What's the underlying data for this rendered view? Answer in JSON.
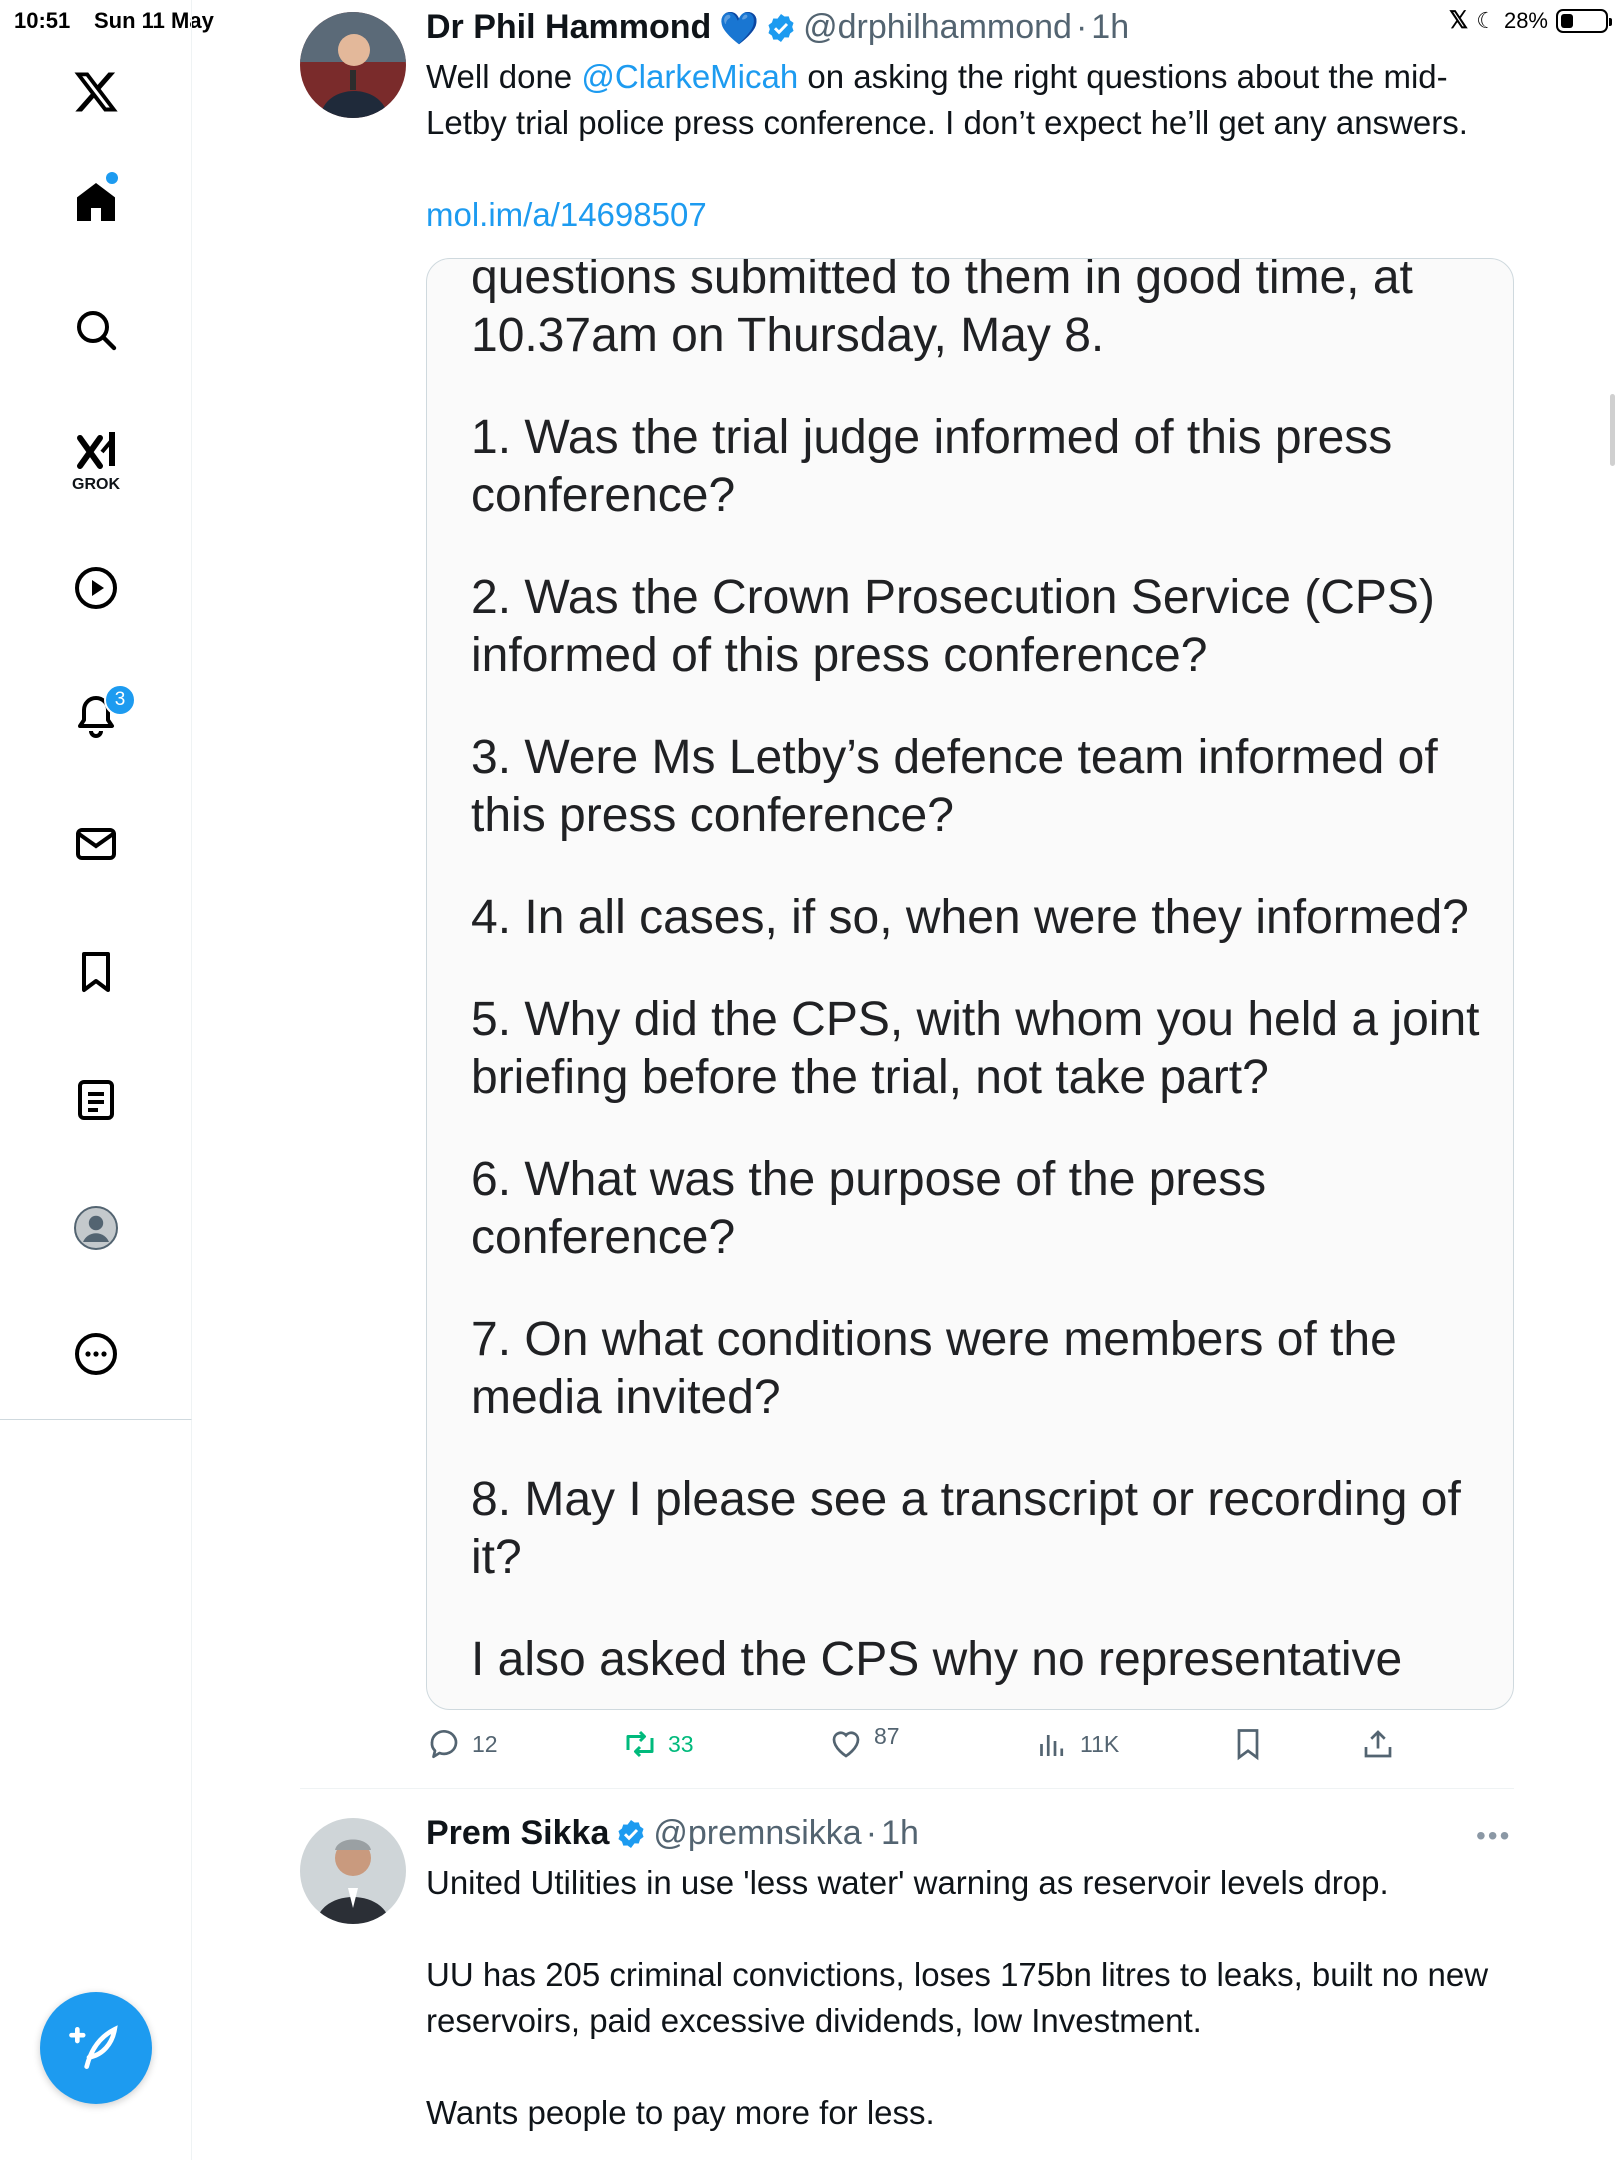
{
  "status_bar": {
    "time": "10:51",
    "date": "Sun 11 May",
    "battery": "28%",
    "battery_level": 0.28
  },
  "sidebar": {
    "items": [
      {
        "name": "x-logo"
      },
      {
        "name": "home"
      },
      {
        "name": "search"
      },
      {
        "name": "grok",
        "label": "GROK"
      },
      {
        "name": "videos"
      },
      {
        "name": "notifications",
        "badge": "3"
      },
      {
        "name": "messages"
      },
      {
        "name": "bookmarks"
      },
      {
        "name": "lists"
      },
      {
        "name": "profile"
      },
      {
        "name": "more"
      }
    ]
  },
  "tweets": [
    {
      "display_name": "Dr Phil Hammond",
      "name_emoji": "💙",
      "handle": "@drphilhammond",
      "sep": "·",
      "time": "1h",
      "text_prefix": "Well done ",
      "mention": "@ClarkeMicah",
      "text_suffix": " on asking the right questions about the mid-Letby trial police press conference. I don’t expect he’ll get any answers.",
      "link": "mol.im/a/14698507",
      "image_lines": [
        "questions submitted to them in good time, at 10.37am on Thursday, May 8.",
        "1. Was the trial judge informed of this press conference?",
        "2. Was the Crown Prosecution Service (CPS) informed of this press conference?",
        "3. Were Ms Letby’s defence team informed of this press conference?",
        "4. In all cases, if so, when were they informed?",
        "5. Why did the CPS, with whom you held a joint briefing before the trial, not take part?",
        "6. What was the purpose of the press conference?",
        "7. On what conditions were members of the media invited?",
        "8. May I please see a transcript or recording of it?",
        "I also asked the CPS why no representative"
      ],
      "replies": "12",
      "reposts": "33",
      "likes": "87",
      "views": "11K"
    },
    {
      "display_name": "Prem Sikka",
      "handle": "@premnsikka",
      "sep": "·",
      "time": "1h",
      "paragraphs": [
        "United Utilities in use 'less water' warning as reservoir levels drop.",
        "UU has 205 criminal convictions, loses 175bn litres to leaks, built no new reservoirs, paid excessive dividends, low Investment.",
        "Wants people to pay more for less."
      ]
    }
  ],
  "colors": {
    "accent": "#1d9bf0",
    "repost_green": "#00ba7c",
    "text": "#0f1419",
    "muted": "#536471"
  }
}
